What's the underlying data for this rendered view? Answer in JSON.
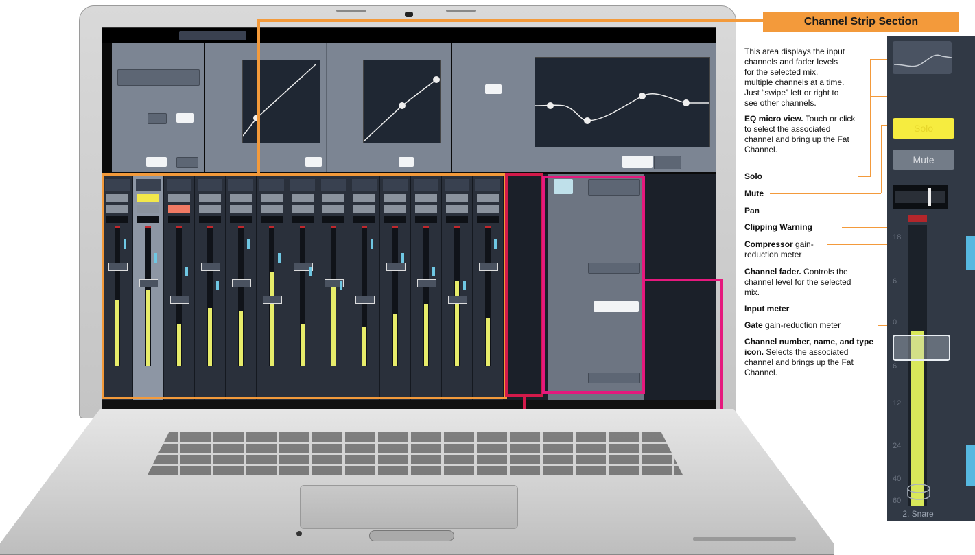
{
  "heading": "Channel Strip Section",
  "annotations": {
    "intro": "This area displays the input channels and fader levels for the selected mix, multiple channels at a time. Just “swipe” left or right to see other channels.",
    "eq_title": "EQ micro view.",
    "eq_desc": " Touch or click to select the associated channel and bring up the Fat Channel.",
    "solo": "Solo",
    "mute": "Mute",
    "pan": "Pan",
    "clipping": "Clipping Warning",
    "comp_title": "Compressor",
    "comp_desc": " gain-reduction meter",
    "fader_title": "Channel fader.",
    "fader_desc": " Controls the channel level for the selected mix.",
    "input_meter": "Input meter",
    "gate_title": "Gate",
    "gate_desc": " gain-reduction meter",
    "chname_title": "Channel number, name, and type icon.",
    "chname_desc": " Selects the associated channel and brings up the Fat Channel."
  },
  "zoom_strip": {
    "solo_label": "Solo",
    "mute_label": "Mute",
    "ticks": [
      "18",
      "6",
      "0",
      "6",
      "12",
      "24",
      "40",
      "60"
    ],
    "channel_name": "2. Snare",
    "colors": {
      "solo": "#f6ec3f",
      "meter": "#d9e85a",
      "gate": "#56b8e0",
      "clip": "#b3262b"
    }
  },
  "screen": {
    "strip_count": 13,
    "meter_levels": [
      0.48,
      0.55,
      0.3,
      0.42,
      0.4,
      0.68,
      0.3,
      0.6,
      0.28,
      0.38,
      0.45,
      0.62,
      0.35
    ]
  },
  "colors": {
    "accent_orange": "#f39a3b",
    "red": "#d31a4a",
    "pink": "#e5197d"
  }
}
